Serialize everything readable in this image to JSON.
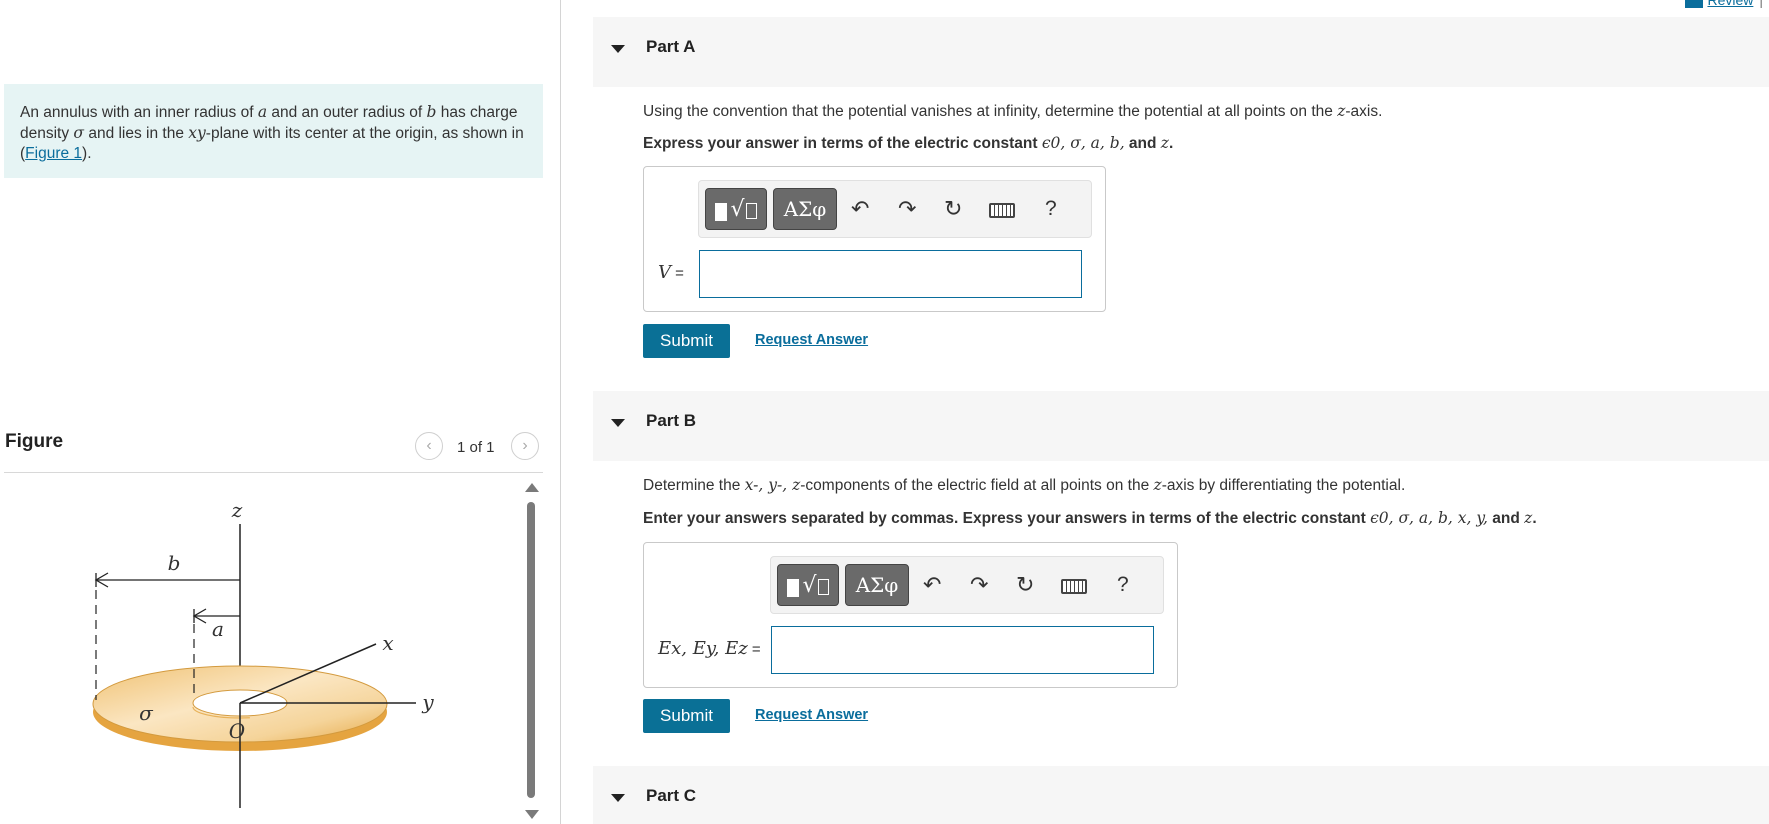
{
  "header": {
    "review_label": "Review",
    "separator": "|"
  },
  "problem": {
    "t1": "An annulus with an inner radius of ",
    "a": "a",
    "t2": " and an outer radius of ",
    "b": "b",
    "t3": " has charge density ",
    "sigma": "σ",
    "t4": " and lies in the ",
    "xy": "xy",
    "t5": "-plane with its center at the origin, as shown in (",
    "figure_link": "Figure 1",
    "t6": ")."
  },
  "figure": {
    "title": "Figure",
    "counter": "1 of 1",
    "labels": {
      "z": "z",
      "b": "b",
      "a": "a",
      "x": "x",
      "y": "y",
      "sigma": "σ",
      "origin": "O"
    }
  },
  "partA": {
    "title": "Part A",
    "question_pre": "Using the convention that the potential vanishes at infinity, determine the potential at all points on the ",
    "question_var": "z",
    "question_post": "-axis.",
    "express_pre": "Express your answer in terms of the electric constant ",
    "express_vars": "ϵ0, σ, a, b,",
    "express_and": " and ",
    "express_last": "z",
    "express_end": ".",
    "answer_label": "V",
    "answer_eq": " =",
    "submit_label": "Submit",
    "request_label": "Request Answer"
  },
  "partB": {
    "title": "Part B",
    "question_pre": "Determine the ",
    "question_vars": "x-, y-, z",
    "question_mid": "-components of the electric field at all points on the ",
    "question_var": "z",
    "question_post": "-axis by differentiating the potential.",
    "express_pre": "Enter your answers separated by commas. Express your answers in terms of the electric constant ",
    "express_vars": "ϵ0, σ, a, b, x, y,",
    "express_and": " and ",
    "express_last": "z",
    "express_end": ".",
    "answer_label": "Ex, Ey, Ez",
    "answer_eq": " =",
    "submit_label": "Submit",
    "request_label": "Request Answer"
  },
  "partC": {
    "title": "Part C"
  },
  "toolbar": {
    "symbols_label": "ΑΣφ",
    "help_label": "?",
    "icons": [
      "templates-icon",
      "greek-symbols-icon",
      "undo-icon",
      "redo-icon",
      "reset-icon",
      "keyboard-icon",
      "help-icon"
    ]
  },
  "colors": {
    "accent": "#0a7096",
    "problem_bg": "#e6f4f4",
    "part_header_bg": "#f6f6f6"
  }
}
